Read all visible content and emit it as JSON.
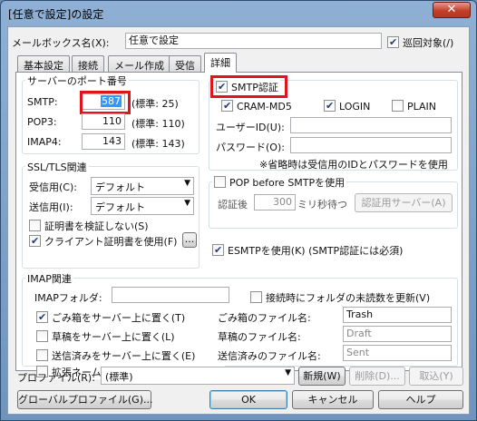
{
  "window": {
    "title": "[任意で設定]の設定",
    "close": "✕"
  },
  "header": {
    "mailbox_label": "メールボックス名(X):",
    "mailbox_value": "任意で設定",
    "patrol_label": "巡回対象(/)"
  },
  "tabs": [
    "基本設定",
    "接続",
    "メール作成",
    "受信",
    "詳細"
  ],
  "ports": {
    "title": "サーバーのポート番号",
    "smtp_label": "SMTP:",
    "smtp_value": "587",
    "smtp_std": "(標準: 25)",
    "pop3_label": "POP3:",
    "pop3_value": "110",
    "pop3_std": "(標準: 110)",
    "imap4_label": "IMAP4:",
    "imap4_value": "143",
    "imap4_std": "(標準: 143)"
  },
  "smtp_auth": {
    "title": "SMTP認証",
    "cram": "CRAM-MD5",
    "login": "LOGIN",
    "plain": "PLAIN",
    "userid_label": "ユーザーID(U):",
    "password_label": "パスワード(O):",
    "note": "※省略時は受信用のIDとパスワードを使用"
  },
  "ssl": {
    "title": "SSL/TLS関連",
    "recv_label": "受信用(C):",
    "recv_value": "デフォルト",
    "send_label": "送信用(I):",
    "send_value": "デフォルト",
    "no_verify": "証明書を検証しない(S)",
    "client_cert": "クライアント証明書を使用(F)",
    "browse": "..."
  },
  "pop_before": {
    "title": "POP before SMTPを使用",
    "after_auth_label": "認証後",
    "ms_value": "300",
    "ms_label": "ミリ秒待つ",
    "server_button": "認証用サーバー(A)"
  },
  "esmtp": {
    "label": "ESMTPを使用(K) (SMTP認証には必須)"
  },
  "imap": {
    "title": "IMAP関連",
    "folder_label": "IMAPフォルダ:",
    "update_unread": "接続時にフォルダの未読数を更新(V)",
    "trash_server": "ごみ箱をサーバー上に置く(T)",
    "trash_name_label": "ごみ箱のファイル名:",
    "trash_name": "Trash",
    "draft_server": "草稿をサーバー上に置く(L)",
    "draft_name_label": "草稿のファイル名:",
    "draft_name": "Draft",
    "sent_server": "送信済みをサーバー上に置く(E)",
    "sent_name_label": "送信済みのファイル名:",
    "sent_name": "Sent",
    "ext_namespace": "拡張ネームスペースをフォルダ表示(H)"
  },
  "profile": {
    "label": "プロファイル(R):",
    "value": "(標準)",
    "new": "新規(W)",
    "delete": "削除(D)...",
    "cancel_profile": "取込(Y)"
  },
  "footer": {
    "global": "グローバルプロファイル(G)...",
    "ok": "OK",
    "cancel": "キャンセル",
    "help": "ヘルプ"
  },
  "colors": {
    "highlight": "#e0141b",
    "selection": "#3399ff"
  }
}
